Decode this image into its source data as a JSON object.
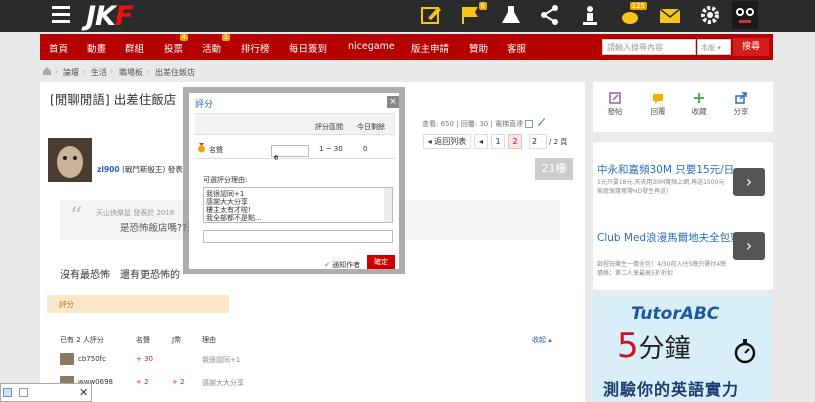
{
  "site": {
    "logo_main": "JK",
    "logo_accent": "F"
  },
  "topbar": {
    "icons": [
      {
        "name": "edit-icon",
        "color": "#f5c518"
      },
      {
        "name": "flag-icon",
        "color": "#f5c518",
        "badge": "6"
      },
      {
        "name": "flask-icon",
        "color": "#ffffff"
      },
      {
        "name": "share-icon",
        "color": "#ffffff"
      },
      {
        "name": "user-icon",
        "color": "#ffffff"
      },
      {
        "name": "piggy-bank-icon",
        "color": "#f5c518",
        "badge": "125"
      },
      {
        "name": "mail-icon",
        "color": "#f5c518"
      },
      {
        "name": "gear-icon",
        "color": "#ffffff"
      }
    ]
  },
  "nav": {
    "items": [
      "首頁",
      "動畫",
      "群組",
      "投票",
      "活動",
      "排行榜",
      "每日簽到",
      "nicegame",
      "版主申請",
      "贊助",
      "客服"
    ],
    "vote_badge": "4",
    "event_badge": "1"
  },
  "search": {
    "placeholder": "請輸入搜尋內容",
    "scope": "本版",
    "button": "搜尋"
  },
  "breadcrumb": {
    "items": [
      "論壇",
      "生活",
      "職場板",
      "出差住飯店"
    ]
  },
  "thread": {
    "title": "[閒聊閒語] 出差住飯店",
    "views": "查看: 650",
    "replies": "回覆: 30",
    "reverse_label": "電梯直達",
    "back_label": "◂ 返回列表",
    "pages": [
      "◂",
      "1",
      "2"
    ],
    "page_input": "2",
    "page_total": "/ 2 頁"
  },
  "post": {
    "author": "zl900",
    "author_title": "(戰鬥斯殷王)",
    "author_extra": "發表",
    "floor": "21樓",
    "quote_meta": "天山快樂鼠 發表於 2016",
    "quote_text": "是恐怖飯店嗎??還真",
    "body": "沒有最恐怖　還有更恐怖的"
  },
  "rating": {
    "tag": "評分",
    "head_participants": "已有 2 人評分",
    "head_fame": "名聲",
    "head_jp": "J幣",
    "head_reason": "理由",
    "head_collapse": "收起 ▴",
    "rows": [
      {
        "user": "cb750fc",
        "fame": "+ 30",
        "jp": "",
        "reason": "我很認同+1"
      },
      {
        "user": "www0698",
        "fame": "+ 2",
        "jp": "+ 2",
        "reason": "感謝大大分享"
      }
    ]
  },
  "sidebar": {
    "buttons": [
      {
        "label": "發帖",
        "icon": "post-icon",
        "color": "#9b59b6"
      },
      {
        "label": "回覆",
        "icon": "reply-icon",
        "color": "#f0b400"
      },
      {
        "label": "收藏",
        "icon": "plus-icon",
        "color": "#4caf50"
      },
      {
        "label": "分享",
        "icon": "share-icon",
        "color": "#2a6fb5"
      }
    ]
  },
  "ads": [
    {
      "title": "中永和嘉頻30M 只要15元/日",
      "desc": "1元只要18元,天天用30M寬頻上網,再送1500元家庭保護寬帶HD發生再送!"
    },
    {
      "title": "Club Med浪漫馬爾地夫全包蜜月",
      "desc": "啟程玩樂生一價全包！4/30前入住5晚只需付4晚價格；第二人享最高5折折扣"
    }
  ],
  "tutor": {
    "logo": "TutorABC",
    "big_num": "5",
    "big_unit": "分鐘",
    "line": "測驗你的英語實力"
  },
  "dialog": {
    "title": "評分",
    "col_range": "評分區間",
    "col_remaining": "今日剩餘",
    "row_label": "名聲",
    "select_value": "0",
    "range": "1 ~ 30",
    "remaining": "0",
    "reason_label": "可選評分理由:",
    "reasons": [
      "我很認同+1",
      "感謝大大分享",
      "樓主太有才啦!",
      "我全部都不是點..."
    ],
    "notify_label": "通知作者",
    "confirm": "確定"
  }
}
